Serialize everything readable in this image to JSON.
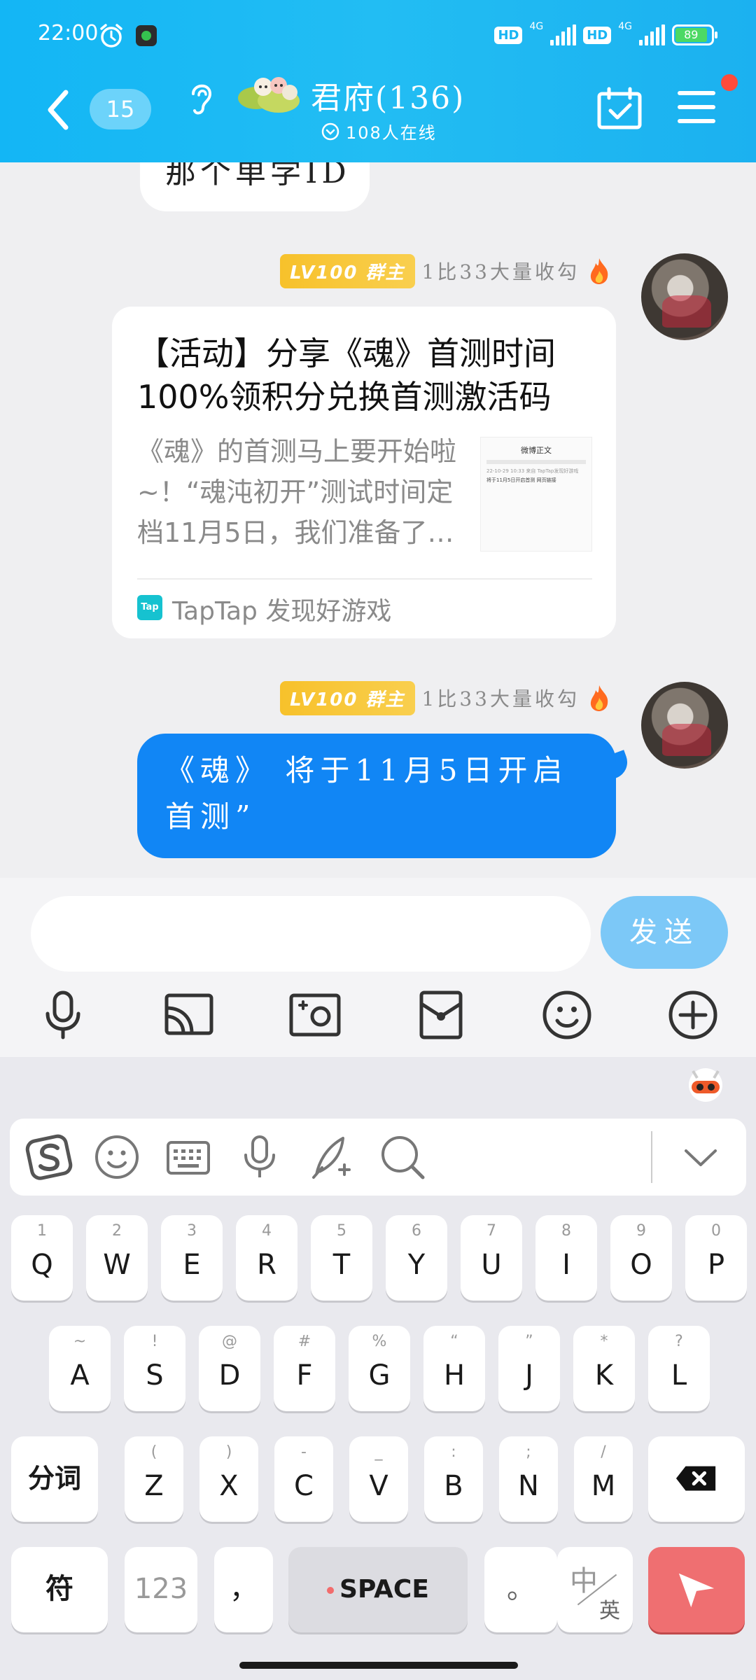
{
  "status_bar": {
    "time": "22:00",
    "hd": "HD",
    "network": "4G",
    "battery": "89",
    "battery_color": "#4cd964"
  },
  "header": {
    "unread_count": "15",
    "group_name": "君府(136)",
    "online_text": "108人在线",
    "bg_color": "#1bb5f3",
    "notification_dot_color": "#ff4b3a"
  },
  "chat": {
    "previous_message_fragment": "那个单学ID",
    "messages": [
      {
        "level_badge": "LV100 群主",
        "sender": "1比33大量收勾",
        "type": "link_card",
        "card": {
          "title": "【活动】分享《魂》首测时间 100%领积分兑换首测激活码",
          "description": "《魂》的首测马上要开始啦~！“魂沌初开”测试时间定档11月5日，我们准备了丰厚福利",
          "thumbnail_title": "微博正文",
          "thumbnail_meta": "22-10-29 10:33 来自 TapTap发现好游戏",
          "thumbnail_line": "将于11月5日开启首测 网页链接",
          "source": "TapTap 发现好游戏",
          "source_logo": "Tap"
        }
      },
      {
        "level_badge": "LV100 群主",
        "sender": "1比33大量收勾",
        "type": "text",
        "text": "《魂》 将于11月5日开启首测”",
        "bubble_color": "#1186f5"
      }
    ]
  },
  "input": {
    "placeholder": "",
    "send_label": "发送",
    "send_color": "#7cc8f7",
    "toolbar_icons": [
      "microphone-icon",
      "screen-cast-icon",
      "photo-icon",
      "red-packet-icon",
      "emoji-icon",
      "plus-icon"
    ]
  },
  "keyboard": {
    "toolbar_icons": [
      "sogou-logo-icon",
      "emoji-icon",
      "keyboard-icon",
      "voice-icon",
      "handwriting-icon",
      "search-icon",
      "collapse-icon"
    ],
    "row1": [
      {
        "hint": "1",
        "key": "Q"
      },
      {
        "hint": "2",
        "key": "W"
      },
      {
        "hint": "3",
        "key": "E"
      },
      {
        "hint": "4",
        "key": "R"
      },
      {
        "hint": "5",
        "key": "T"
      },
      {
        "hint": "6",
        "key": "Y"
      },
      {
        "hint": "7",
        "key": "U"
      },
      {
        "hint": "8",
        "key": "I"
      },
      {
        "hint": "9",
        "key": "O"
      },
      {
        "hint": "0",
        "key": "P"
      }
    ],
    "row2": [
      {
        "hint": "~",
        "key": "A"
      },
      {
        "hint": "!",
        "key": "S"
      },
      {
        "hint": "@",
        "key": "D"
      },
      {
        "hint": "#",
        "key": "F"
      },
      {
        "hint": "%",
        "key": "G"
      },
      {
        "hint": "“",
        "key": "H"
      },
      {
        "hint": "”",
        "key": "J"
      },
      {
        "hint": "*",
        "key": "K"
      },
      {
        "hint": "?",
        "key": "L"
      }
    ],
    "row3": [
      {
        "hint": "(",
        "key": "Z"
      },
      {
        "hint": ")",
        "key": "X"
      },
      {
        "hint": "-",
        "key": "C"
      },
      {
        "hint": "_",
        "key": "V"
      },
      {
        "hint": ":",
        "key": "B"
      },
      {
        "hint": ";",
        "key": "N"
      },
      {
        "hint": "/",
        "key": "M"
      }
    ],
    "segment_label": "分词",
    "symbol_label": "符",
    "numeric_label": "123",
    "comma_label": "，",
    "space_label": "SPACE",
    "period_label": "。",
    "lang_cn": "中",
    "lang_en": "英",
    "enter_color": "#ef6f71"
  }
}
